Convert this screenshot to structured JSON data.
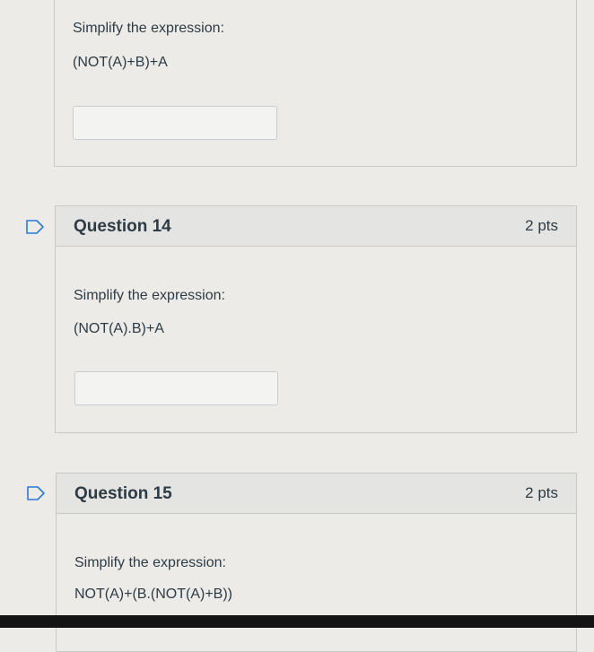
{
  "questions": [
    {
      "prompt": "Simplify the expression:",
      "expression": "(NOT(A)+B)+A",
      "answer_value": ""
    },
    {
      "title": "Question 14",
      "points": "2 pts",
      "prompt": "Simplify the expression:",
      "expression": "(NOT(A).B)+A",
      "answer_value": ""
    },
    {
      "title": "Question 15",
      "points": "2 pts",
      "prompt": "Simplify the expression:",
      "expression": "NOT(A)+(B.(NOT(A)+B))"
    }
  ],
  "icons": {
    "flag": "flag-question-icon"
  },
  "colors": {
    "background": "#ecebe8",
    "header": "#e4e4e2",
    "text": "#2d3b45",
    "flag_stroke": "#2b7bd6"
  }
}
